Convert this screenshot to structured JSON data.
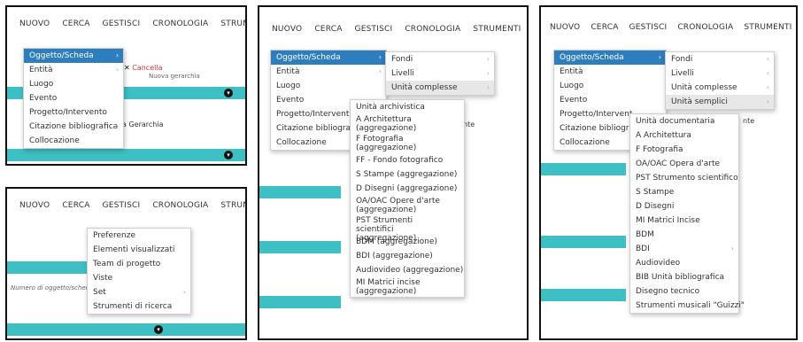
{
  "menubar": {
    "nuovo": "NUOVO",
    "cerca": "CERCA",
    "gestisci": "GESTISCI",
    "cronologia": "CRONOLOGIA",
    "strumenti": "STRUMENTI"
  },
  "panel1": {
    "menu": [
      "Oggetto/Scheda",
      "Entità",
      "Luogo",
      "Evento",
      "Progetto/Intervento",
      "Citazione bibliografica",
      "Collocazione"
    ],
    "cancel": "Cancella",
    "gerarchia": "a Gerarchia",
    "hint": "Nuova gerarchia"
  },
  "panel2": {
    "menu": [
      "Preferenze",
      "Elementi visualizzati",
      "Team di progetto",
      "Viste",
      "Set",
      "Strumenti di ricerca"
    ],
    "search_hint": "Numero di oggetto/scheda a"
  },
  "panel3": {
    "menu": [
      "Oggetto/Scheda",
      "Entità",
      "Luogo",
      "Evento",
      "Progetto/Interventi",
      "Citazione bibliografica",
      "Collocazione"
    ],
    "submenu": [
      "Fondi",
      "Livelli",
      "Unità complesse"
    ],
    "subsub": [
      "Unità archivistica",
      "A Architettura (aggregazione)",
      "F Fotografia (aggregazione)",
      "FF - Fondo fotografico",
      "S Stampe (aggregazione)",
      "D Disegni (aggregazione)",
      "OA/OAC Opere d'arte (aggregazione)",
      "PST Strumenti scientifici (aggregazione)",
      "BDM (aggregazione)",
      "BDI (aggregazione)",
      "Audiovideo (aggregazione)",
      "MI Matrici incise (aggregazione)"
    ],
    "side": "nte"
  },
  "panel4": {
    "menu": [
      "Oggetto/Scheda",
      "Entità",
      "Luogo",
      "Evento",
      "Progetto/Intervent",
      "Citazione bibliogra",
      "Collocazione"
    ],
    "submenu": [
      "Fondi",
      "Livelli",
      "Unità complesse",
      "Unità semplici"
    ],
    "subsub": [
      "Unità documentaria",
      "A Architettura",
      "F Fotografia",
      "OA/OAC Opera d'arte",
      "PST Strumento scientifico",
      "S Stampe",
      "D Disegni",
      "MI Matrici Incise",
      "BDM",
      "BDI",
      "Audiovideo",
      "BIB Unità bibliografica",
      "Disegno tecnico",
      "Strumenti musicali \"Guizzi\""
    ],
    "side": "nte"
  }
}
